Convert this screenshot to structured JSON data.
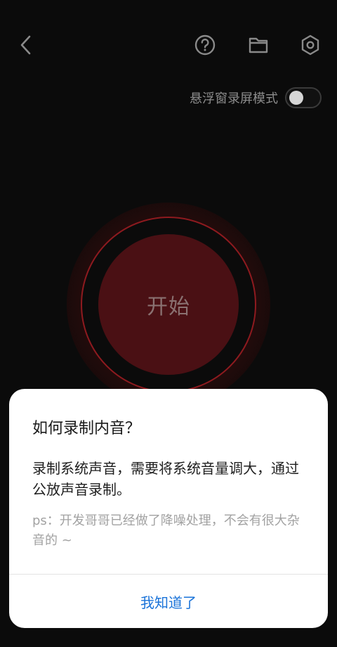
{
  "toolbar": {
    "icons": {
      "back": "chevron-left-icon",
      "help": "question-circle-icon",
      "folder": "folder-icon",
      "settings": "gear-hexagon-icon"
    }
  },
  "floating_mode": {
    "label": "悬浮窗录屏模式",
    "enabled": false
  },
  "record": {
    "start_label": "开始"
  },
  "dialog": {
    "title": "如何录制内音？",
    "body": "录制系统声音，需要将系统音量调大，通过公放声音录制。",
    "note": "ps：开发哥哥已经做了降噪处理，不会有很大杂音的 ~",
    "confirm_label": "我知道了"
  },
  "colors": {
    "background": "#0b0b0b",
    "record_fill": "#4a1014",
    "record_ring": "#8e1a1f",
    "accent_blue": "#1a73d9"
  }
}
